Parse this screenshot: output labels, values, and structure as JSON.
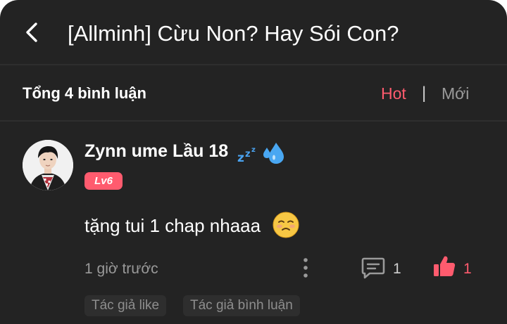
{
  "header": {
    "title": "[Allminh] Cừu Non? Hay Sói Con?",
    "back_icon": "chevron-left-icon"
  },
  "comments_bar": {
    "total_label": "Tổng 4 bình luận",
    "sort_hot": "Hot",
    "separator": "|",
    "sort_new": "Mới"
  },
  "comment": {
    "username": "Zynn ume Lầu 18",
    "level": "Lv6",
    "text": "tặng tui 1 chap nhaaa",
    "time": "1 giờ trước",
    "reply_count": "1",
    "like_count": "1",
    "tags": [
      "Tác giả like",
      "Tác giả bình luận"
    ]
  },
  "colors": {
    "background": "#232323",
    "accent": "#ff5b6e",
    "muted": "#9a9a9a",
    "divider": "#2e2e2e"
  }
}
